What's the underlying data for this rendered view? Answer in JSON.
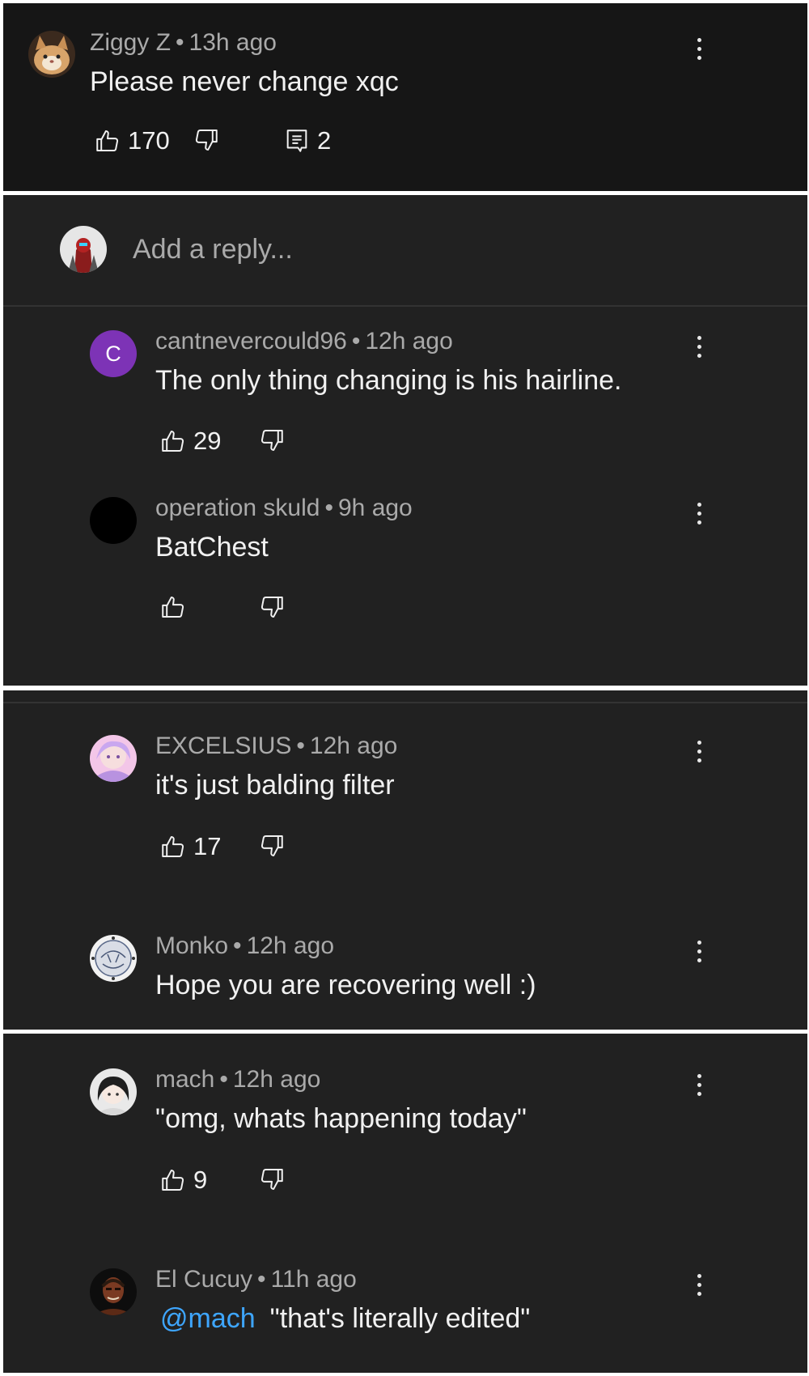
{
  "main_comment": {
    "author": "Ziggy Z",
    "time": "13h ago",
    "text": "Please never change xqc",
    "likes": "170",
    "replies": "2",
    "menu_icon": "more-vert-icon"
  },
  "reply_box": {
    "placeholder": "Add a reply..."
  },
  "replies": [
    {
      "author": "cantnevercould96",
      "time": "12h ago",
      "text": "The only thing changing is his hairline.",
      "likes": "29",
      "avatar_letter": "C",
      "avatar_color": "#7d33b6"
    },
    {
      "author": "operation skuld",
      "time": "9h ago",
      "text": "BatChest",
      "likes": ""
    },
    {
      "author": "EXCELSIUS",
      "time": "12h ago",
      "text": "it's just balding filter",
      "likes": "17"
    },
    {
      "author": "Monko",
      "time": "12h ago",
      "text": "Hope you are recovering well :)"
    },
    {
      "author": "mach",
      "time": "12h ago",
      "text": "\"omg, whats happening today\"",
      "likes": "9"
    },
    {
      "author": "El Cucuy",
      "time": "11h ago",
      "mention": "@mach",
      "text": "\"that's literally edited\""
    }
  ],
  "icons": {
    "like": "thumb-up-icon",
    "dislike": "thumb-down-icon",
    "reply": "comment-icon",
    "menu": "more-vert-icon"
  },
  "colors": {
    "background": "#212121",
    "header_background": "#161616",
    "mention": "#3ea6ff",
    "meta_text": "#aaaaaa"
  }
}
